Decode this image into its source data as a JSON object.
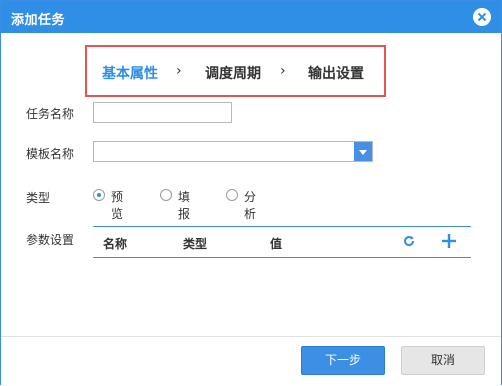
{
  "dialog": {
    "title": "添加任务"
  },
  "steps": {
    "step1": "基本属性",
    "step2": "调度周期",
    "step3": "输出设置",
    "separator": "›"
  },
  "form": {
    "task_name_label": "任务名称",
    "task_name_value": "",
    "template_label": "模板名称",
    "template_value": "",
    "type_label": "类型",
    "type_options": [
      "预览",
      "填报",
      "分析"
    ],
    "type_selected": "预览",
    "params_label": "参数设置"
  },
  "params_table": {
    "columns": [
      "名称",
      "类型",
      "值"
    ]
  },
  "buttons": {
    "next": "下一步",
    "cancel": "取消"
  },
  "colors": {
    "accent": "#2f8ee5",
    "highlight_border": "#e05555"
  },
  "icons": [
    "close-icon",
    "refresh-icon",
    "plus-icon",
    "chevron-down-icon"
  ]
}
